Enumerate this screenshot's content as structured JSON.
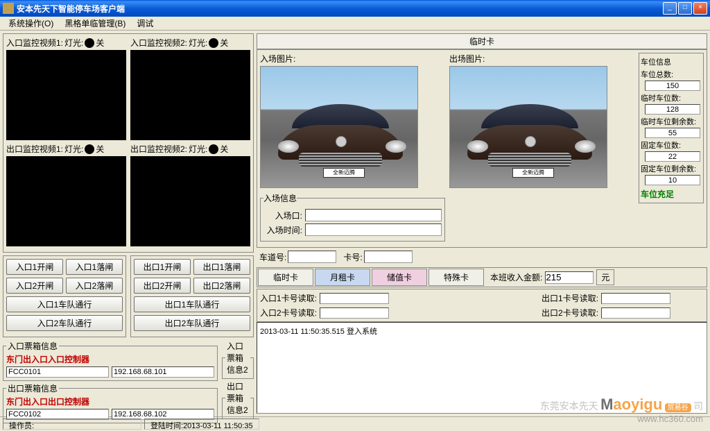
{
  "window": {
    "title": "安本先天下智能停车场客户端",
    "min": "_",
    "max": "□",
    "close": "×"
  },
  "menu": {
    "system": "系统操作(O)",
    "blacklist": "黑格单临管理(B)",
    "debug": "调试"
  },
  "video": {
    "in1": {
      "label": "入口监控视频1:",
      "light": "灯光:",
      "state": "关"
    },
    "in2": {
      "label": "入口监控视频2:",
      "light": "灯光:",
      "state": "关"
    },
    "out1": {
      "label": "出口监控视频1:",
      "light": "灯光:",
      "state": "关"
    },
    "out2": {
      "label": "出口监控视频2:",
      "light": "灯光:",
      "state": "关"
    }
  },
  "entry_ctrl": {
    "in1_open": "入口1开闸",
    "in1_close": "入口1落闸",
    "in2_open": "入口2开闸",
    "in2_close": "入口2落闸",
    "in1_queue": "入口1车队通行",
    "in2_queue": "入口2车队通行"
  },
  "exit_ctrl": {
    "out1_open": "出口1开闸",
    "out1_close": "出口1落闸",
    "out2_open": "出口2开闸",
    "out2_close": "出口2落闸",
    "out1_queue": "出口1车队通行",
    "out2_queue": "出口2车队通行"
  },
  "boxinfo": {
    "in_title": "入口票箱信息",
    "in_desc": "东门出入口入口控制器",
    "in_code": "FCC0101",
    "in_ip": "192.168.68.101",
    "out_title": "出口票箱信息",
    "out_desc": "东门出入口出口控制器",
    "out_code": "FCC0102",
    "out_ip": "192.168.68.102",
    "in2_title": "入口票箱信息2",
    "out2_title": "出口票箱信息2"
  },
  "card_header": "临时卡",
  "photos": {
    "entry_label": "入场图片:",
    "exit_label": "出场图片:",
    "plate_text": "全新迈腾"
  },
  "stats": {
    "box_title": "车位信息",
    "total_label": "车位总数:",
    "total": "150",
    "remain_label": "临时车位数:",
    "remain": "128",
    "temp_remain_label": "临时车位剩余数:",
    "temp_remain": "55",
    "fixed_label": "固定车位数:",
    "fixed": "22",
    "fixed_remain_label": "固定车位剩余数:",
    "fixed_remain": "10",
    "warn": "车位充足"
  },
  "entry_info": {
    "title": "入场信息",
    "gate_label": "入场口:",
    "time_label": "入场时间:"
  },
  "bottom_fields": {
    "lane": "车道号:",
    "card": "卡号:"
  },
  "tabs": {
    "temp": "临时卡",
    "month": "月租卡",
    "stored": "储值卡",
    "special": "特殊卡"
  },
  "income": {
    "label": "本班收入金额:",
    "value": "215",
    "unit": "元"
  },
  "card_read": {
    "in1": "入口1卡号读取:",
    "in2": "入口2卡号读取:",
    "out1": "出口1卡号读取:",
    "out2": "出口2卡号读取:"
  },
  "log": {
    "line1": "2013-03-11 11:50:35.515  登入系统"
  },
  "status": {
    "op": "操作员:",
    "time_label": "登陆时间:",
    "time": "2013-03-11 11:50:35"
  },
  "watermark": {
    "gray": "东莞安本先天",
    "suffix": "司",
    "logo_m": "M",
    "logo_rest": "aoyigu",
    "badge": "贸易谷",
    "site": "www.hc360.com"
  }
}
